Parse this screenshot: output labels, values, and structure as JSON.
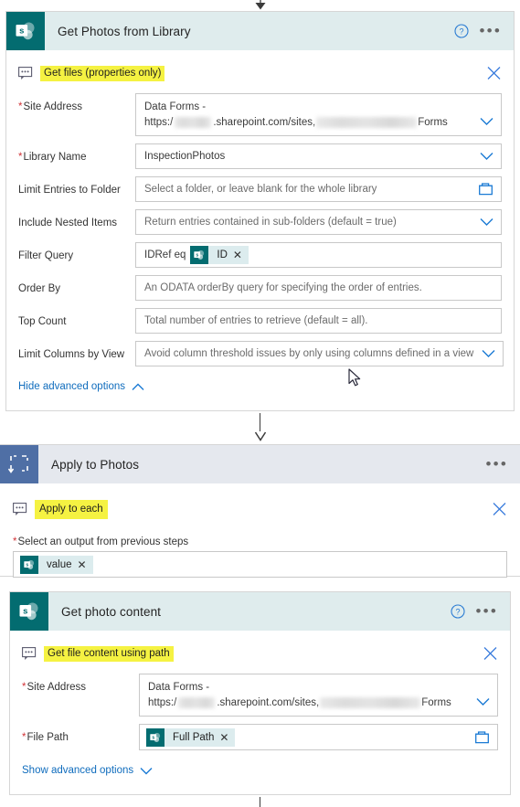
{
  "theme": {
    "sharepoint_teal": "#036C70",
    "loop_blue": "#4F6FA5",
    "header_teal_bg": "#DFECED",
    "header_loop_bg": "#E5E8EE",
    "highlight_yellow": "#F5F242",
    "link_blue": "#0F6CBD",
    "required_red": "#D13438",
    "chip_bg": "#DCECEE"
  },
  "icons": {
    "sharepoint": "sharepoint-icon",
    "loop": "apply-to-each-icon",
    "comment": "comment-bubble-icon",
    "help": "help-circle-icon",
    "more": "more-options-icon",
    "close": "close-icon",
    "chevron_down": "chevron-down-icon",
    "chevron_up": "chevron-up-icon",
    "folder": "folder-picker-icon",
    "arrow_down": "flow-arrow-icon",
    "cursor": "mouse-cursor"
  },
  "cards": [
    {
      "id": "get-photos-from-library",
      "title": "Get Photos from Library",
      "action_label": "Get files (properties only)",
      "connector": "sharepoint",
      "has_help": true,
      "has_more": true,
      "has_close": true,
      "fields": [
        {
          "name": "site-address",
          "label": "Site Address",
          "required": true,
          "type": "dropdown-two-line",
          "line1": "Data Forms -",
          "line2_prefix": "https:/",
          "line2_mid": ".sharepoint.com/sites,",
          "line2_suffix": "Forms",
          "redacted": true
        },
        {
          "name": "library-name",
          "label": "Library Name",
          "required": true,
          "type": "dropdown",
          "value": "InspectionPhotos"
        },
        {
          "name": "limit-entries-to-folder",
          "label": "Limit Entries to Folder",
          "required": false,
          "type": "folder",
          "placeholder": "Select a folder, or leave blank for the whole library"
        },
        {
          "name": "include-nested-items",
          "label": "Include Nested Items",
          "required": false,
          "type": "dropdown",
          "placeholder": "Return entries contained in sub-folders (default = true)"
        },
        {
          "name": "filter-query",
          "label": "Filter Query",
          "required": false,
          "type": "token",
          "prefix": "IDRef eq",
          "token": "ID"
        },
        {
          "name": "order-by",
          "label": "Order By",
          "required": false,
          "type": "text",
          "placeholder": "An ODATA orderBy query for specifying the order of entries."
        },
        {
          "name": "top-count",
          "label": "Top Count",
          "required": false,
          "type": "text",
          "placeholder": "Total number of entries to retrieve (default = all)."
        },
        {
          "name": "limit-columns-by-view",
          "label": "Limit Columns by View",
          "required": false,
          "type": "dropdown",
          "placeholder": "Avoid column threshold issues by only using columns defined in a view"
        }
      ],
      "advanced_label": "Hide advanced options",
      "advanced_state": "expanded"
    },
    {
      "id": "apply-to-photos",
      "title": "Apply to Photos",
      "action_label": "Apply to each",
      "connector": "loop",
      "has_help": false,
      "has_more": true,
      "has_close": true,
      "output_label": "Select an output from previous steps",
      "output_required": true,
      "output_token": "value"
    },
    {
      "id": "get-photo-content",
      "title": "Get photo content",
      "action_label": "Get file content using path",
      "connector": "sharepoint",
      "has_help": true,
      "has_more": true,
      "has_close": true,
      "fields": [
        {
          "name": "site-address",
          "label": "Site Address",
          "required": true,
          "type": "dropdown-two-line",
          "line1": "Data Forms -",
          "line2_prefix": "https:/",
          "line2_mid": ".sharepoint.com/sites,",
          "line2_suffix": "Forms",
          "redacted": true
        },
        {
          "name": "file-path",
          "label": "File Path",
          "required": true,
          "type": "token-folder",
          "token": "Full Path"
        }
      ],
      "advanced_label": "Show advanced options",
      "advanced_state": "collapsed"
    }
  ]
}
